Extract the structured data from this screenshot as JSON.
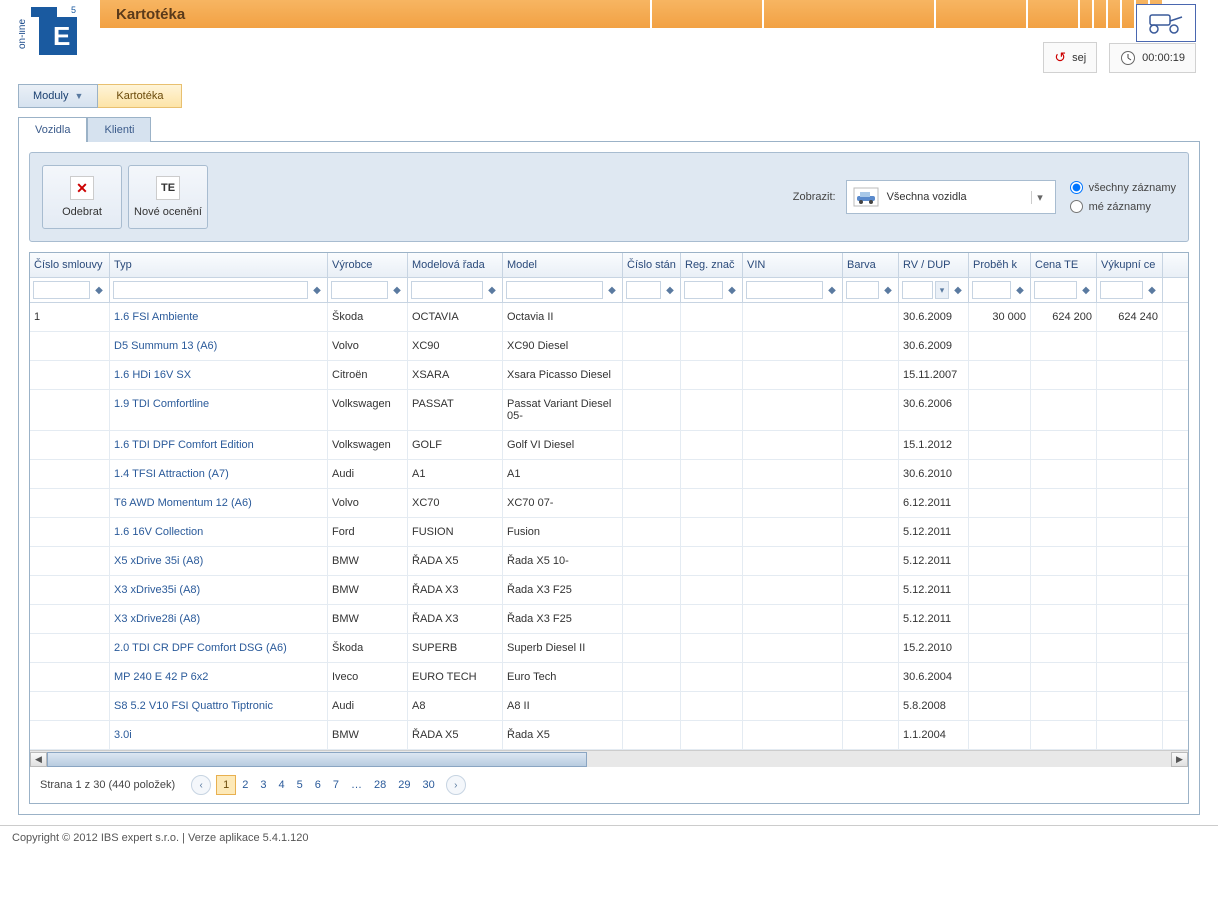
{
  "header": {
    "title": "Kartotéka",
    "user": "sej",
    "timer": "00:00:19"
  },
  "menu": {
    "moduly": "Moduly",
    "breadcrumb": "Kartotéka"
  },
  "tabs": {
    "vozidla": "Vozidla",
    "klienti": "Klienti"
  },
  "toolbar": {
    "odebrat": "Odebrat",
    "nove_oceneni": "Nové ocenění",
    "zobrazit_label": "Zobrazit:",
    "combo_text": "Všechna vozidla",
    "radio_all": "všechny záznamy",
    "radio_my": "mé záznamy"
  },
  "columns": {
    "c0": "Číslo smlouvy",
    "c1": "Typ",
    "c2": "Výrobce",
    "c3": "Modelová řada",
    "c4": "Model",
    "c5": "Číslo stán",
    "c6": "Reg. znač",
    "c7": "VIN",
    "c8": "Barva",
    "c9": "RV / DUP",
    "c10": "Proběh k",
    "c11": "Cena TE",
    "c12": "Výkupní ce"
  },
  "rows": [
    {
      "smlouva": "1",
      "typ": "1.6 FSI Ambiente",
      "vyrobce": "Škoda",
      "rada": "OCTAVIA",
      "model": "Octavia II",
      "rv": "30.6.2009",
      "probeh": "30 000",
      "cena": "624 200",
      "vykup": "624 240"
    },
    {
      "smlouva": "",
      "typ": "D5 Summum 13 (A6)",
      "vyrobce": "Volvo",
      "rada": "XC90",
      "model": "XC90 Diesel",
      "rv": "30.6.2009",
      "probeh": "",
      "cena": "",
      "vykup": ""
    },
    {
      "smlouva": "",
      "typ": "1.6 HDi 16V SX",
      "vyrobce": "Citroën",
      "rada": "XSARA",
      "model": "Xsara Picasso Diesel",
      "rv": "15.11.2007",
      "probeh": "",
      "cena": "",
      "vykup": ""
    },
    {
      "smlouva": "",
      "typ": "1.9 TDI Comfortline",
      "vyrobce": "Volkswagen",
      "rada": "PASSAT",
      "model": "Passat Variant Diesel 05-",
      "rv": "30.6.2006",
      "probeh": "",
      "cena": "",
      "vykup": ""
    },
    {
      "smlouva": "",
      "typ": "1.6 TDI DPF Comfort Edition",
      "vyrobce": "Volkswagen",
      "rada": "GOLF",
      "model": "Golf VI Diesel",
      "rv": "15.1.2012",
      "probeh": "",
      "cena": "",
      "vykup": ""
    },
    {
      "smlouva": "",
      "typ": "1.4 TFSI Attraction (A7)",
      "vyrobce": "Audi",
      "rada": "A1",
      "model": "A1",
      "rv": "30.6.2010",
      "probeh": "",
      "cena": "",
      "vykup": ""
    },
    {
      "smlouva": "",
      "typ": "T6 AWD Momentum 12 (A6)",
      "vyrobce": "Volvo",
      "rada": "XC70",
      "model": "XC70 07-",
      "rv": "6.12.2011",
      "probeh": "",
      "cena": "",
      "vykup": ""
    },
    {
      "smlouva": "",
      "typ": "1.6 16V Collection",
      "vyrobce": "Ford",
      "rada": "FUSION",
      "model": "Fusion",
      "rv": "5.12.2011",
      "probeh": "",
      "cena": "",
      "vykup": ""
    },
    {
      "smlouva": "",
      "typ": "X5 xDrive 35i (A8)",
      "vyrobce": "BMW",
      "rada": "ŘADA X5",
      "model": "Řada X5 10-",
      "rv": "5.12.2011",
      "probeh": "",
      "cena": "",
      "vykup": ""
    },
    {
      "smlouva": "",
      "typ": "X3 xDrive35i (A8)",
      "vyrobce": "BMW",
      "rada": "ŘADA X3",
      "model": "Řada X3 F25",
      "rv": "5.12.2011",
      "probeh": "",
      "cena": "",
      "vykup": ""
    },
    {
      "smlouva": "",
      "typ": "X3 xDrive28i (A8)",
      "vyrobce": "BMW",
      "rada": "ŘADA X3",
      "model": "Řada X3 F25",
      "rv": "5.12.2011",
      "probeh": "",
      "cena": "",
      "vykup": ""
    },
    {
      "smlouva": "",
      "typ": "2.0 TDI CR DPF Comfort DSG (A6)",
      "vyrobce": "Škoda",
      "rada": "SUPERB",
      "model": "Superb Diesel II",
      "rv": "15.2.2010",
      "probeh": "",
      "cena": "",
      "vykup": ""
    },
    {
      "smlouva": "",
      "typ": "MP 240 E 42 P 6x2",
      "vyrobce": "Iveco",
      "rada": "EURO TECH",
      "model": "Euro Tech",
      "rv": "30.6.2004",
      "probeh": "",
      "cena": "",
      "vykup": ""
    },
    {
      "smlouva": "",
      "typ": "S8 5.2 V10 FSI Quattro Tiptronic",
      "vyrobce": "Audi",
      "rada": "A8",
      "model": "A8 II",
      "rv": "5.8.2008",
      "probeh": "",
      "cena": "",
      "vykup": ""
    },
    {
      "smlouva": "",
      "typ": "3.0i",
      "vyrobce": "BMW",
      "rada": "ŘADA X5",
      "model": "Řada X5",
      "rv": "1.1.2004",
      "probeh": "",
      "cena": "",
      "vykup": ""
    }
  ],
  "pager": {
    "summary": "Strana 1 z 30 (440 položek)",
    "pages": [
      "1",
      "2",
      "3",
      "4",
      "5",
      "6",
      "7",
      "…",
      "28",
      "29",
      "30"
    ]
  },
  "footer": {
    "copyright": "Copyright © 2012 IBS expert s.r.o. | Verze aplikace 5.4.1.120"
  }
}
